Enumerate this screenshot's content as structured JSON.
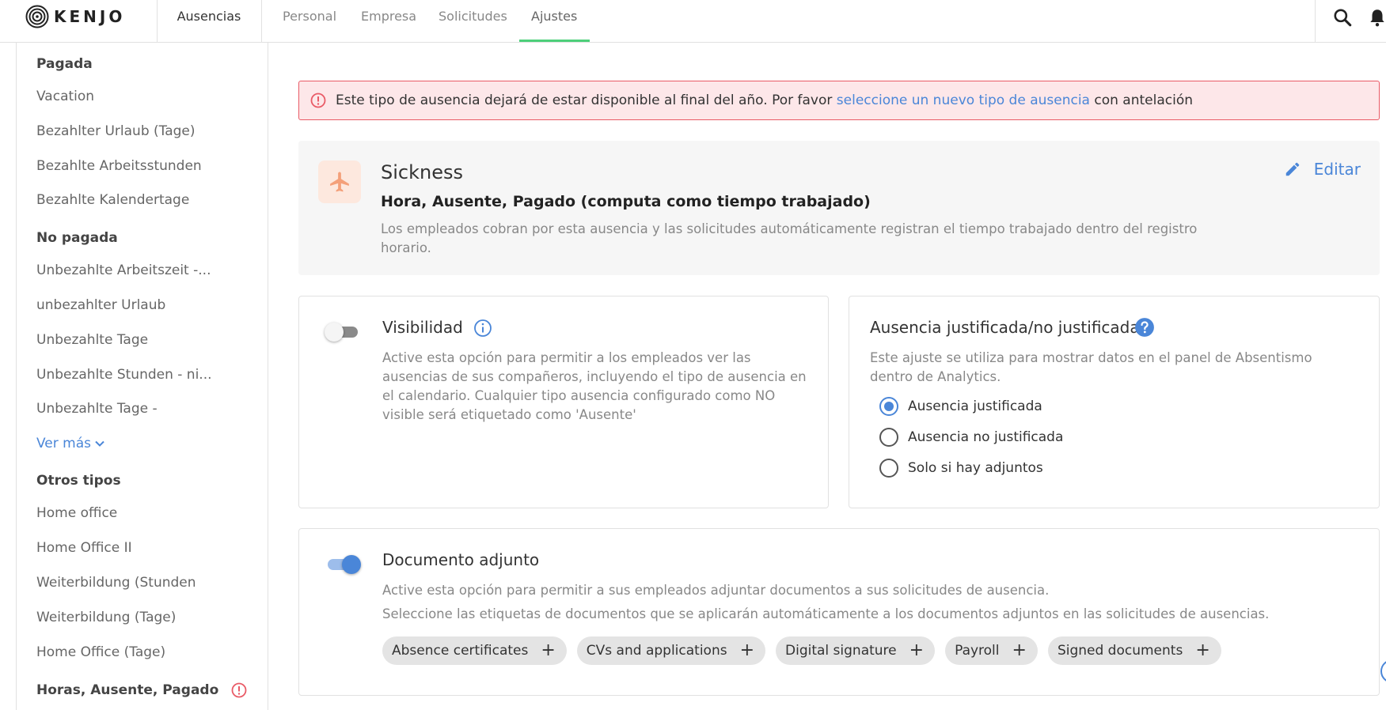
{
  "app": {
    "logo_text": "KENJO"
  },
  "topnav": {
    "main_section": "Ausencias",
    "tabs": [
      {
        "label": "Personal"
      },
      {
        "label": "Empresa"
      },
      {
        "label": "Solicitudes"
      },
      {
        "label": "Ajustes",
        "active": true
      }
    ],
    "icons": [
      "search-icon",
      "bell-icon"
    ]
  },
  "sidebar": {
    "groups": [
      {
        "heading": "Pagada",
        "items": [
          "Vacation",
          "Bezahlter Urlaub (Tage)",
          "Bezahlte Arbeitsstunden",
          "Bezahlte Kalendertage"
        ]
      },
      {
        "heading": "No pagada",
        "items": [
          "Unbezahlte Arbeitszeit -...",
          "unbezahlter Urlaub",
          "Unbezahlte Tage",
          "Unbezahlte Stunden - ni...",
          "Unbezahlte Tage -"
        ],
        "more_label": "Ver más"
      },
      {
        "heading": "Otros tipos",
        "items": [
          "Home office",
          "Home Office II",
          "Weiterbildung (Stunden",
          "Weiterbildung (Tage)",
          "Home Office (Tage)"
        ]
      },
      {
        "heading": "Horas, Ausente, Pagado",
        "has_alert": true
      }
    ]
  },
  "alert": {
    "text_before": "Este tipo de ausencia dejará de estar disponible al final del año. Por favor ",
    "link_text": "seleccione un nuevo tipo de ausencia",
    "text_after": " con antelación"
  },
  "absence_type": {
    "icon": "airplane-icon",
    "name": "Sickness",
    "subtitle": "Hora, Ausente, Pagado (computa como tiempo trabajado)",
    "description": "Los empleados cobran por esta ausencia y las solicitudes automáticamente registran el tiempo trabajado dentro del registro horario.",
    "edit_label": "Editar"
  },
  "visibility": {
    "title": "Visibilidad",
    "enabled": false,
    "description": "Active esta opción para permitir a los empleados ver las ausencias de sus compañeros, incluyendo el tipo de ausencia en el calendario. Cualquier tipo ausencia configurado como NO visible será etiquetado como 'Ausente'"
  },
  "justification": {
    "title": "Ausencia justificada/no justificada",
    "description": "Este ajuste se utiliza para mostrar datos en el panel de Absentismo dentro de Analytics.",
    "options": [
      {
        "label": "Ausencia justificada",
        "checked": true
      },
      {
        "label": "Ausencia no justificada",
        "checked": false
      },
      {
        "label": "Solo si hay adjuntos",
        "checked": false
      }
    ]
  },
  "attachment": {
    "title": "Documento adjunto",
    "enabled": true,
    "description_1": "Active esta opción para permitir a sus empleados adjuntar documentos a sus solicitudes de ausencia.",
    "description_2": "Seleccione las etiquetas de documentos que se aplicarán automáticamente a los documentos adjuntos en las solicitudes de ausencias.",
    "tags": [
      "Absence certificates",
      "CVs and applications",
      "Digital signature",
      "Payroll",
      "Signed documents"
    ],
    "tag_add_symbol": "+"
  },
  "colors": {
    "accent": "#4a86d8",
    "active_tab": "#4dcf7a",
    "alert_bg": "#fde7e9",
    "alert_border": "#e95a66",
    "type_icon": "#f4a07a"
  }
}
